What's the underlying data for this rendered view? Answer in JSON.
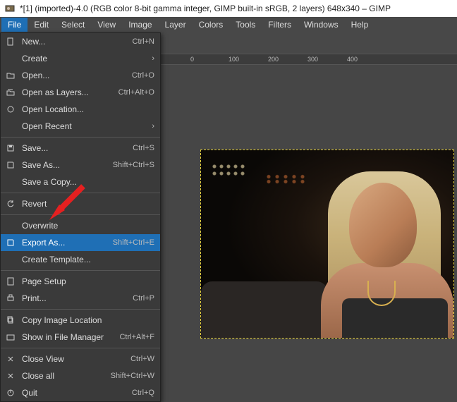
{
  "title": "*[1] (imported)-4.0 (RGB color 8-bit gamma integer, GIMP built-in sRGB, 2 layers) 648x340 – GIMP",
  "menubar": [
    "File",
    "Edit",
    "Select",
    "View",
    "Image",
    "Layer",
    "Colors",
    "Tools",
    "Filters",
    "Windows",
    "Help"
  ],
  "ruler": [
    "0",
    "100",
    "200",
    "300",
    "400"
  ],
  "menu": {
    "new": {
      "label": "New...",
      "accel": "Ctrl+N"
    },
    "create": {
      "label": "Create",
      "sub": "›"
    },
    "open": {
      "label": "Open...",
      "accel": "Ctrl+O"
    },
    "openlayers": {
      "label": "Open as Layers...",
      "accel": "Ctrl+Alt+O"
    },
    "openloc": {
      "label": "Open Location..."
    },
    "openrecent": {
      "label": "Open Recent",
      "sub": "›"
    },
    "save": {
      "label": "Save...",
      "accel": "Ctrl+S"
    },
    "saveas": {
      "label": "Save As...",
      "accel": "Shift+Ctrl+S"
    },
    "savecopy": {
      "label": "Save a Copy..."
    },
    "revert": {
      "label": "Revert"
    },
    "overwrite": {
      "label": "Overwrite"
    },
    "exportas": {
      "label": "Export As...",
      "accel": "Shift+Ctrl+E"
    },
    "template": {
      "label": "Create Template..."
    },
    "pagesetup": {
      "label": "Page Setup"
    },
    "print": {
      "label": "Print...",
      "accel": "Ctrl+P"
    },
    "copyloc": {
      "label": "Copy Image Location"
    },
    "showfm": {
      "label": "Show in File Manager",
      "accel": "Ctrl+Alt+F"
    },
    "closeview": {
      "label": "Close View",
      "accel": "Ctrl+W"
    },
    "closeall": {
      "label": "Close all",
      "accel": "Shift+Ctrl+W"
    },
    "quit": {
      "label": "Quit",
      "accel": "Ctrl+Q"
    }
  }
}
